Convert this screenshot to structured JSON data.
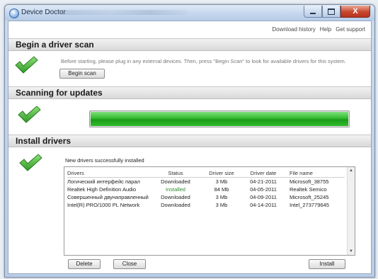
{
  "window": {
    "title": "Device Doctor",
    "controls": {
      "minimize": "minimize",
      "maximize": "maximize",
      "close": "X"
    }
  },
  "top_links": [
    "Download history",
    "Help",
    "Get support"
  ],
  "sections": {
    "scan": {
      "title": "Begin a driver scan",
      "instruction": "Before starting, please plug in any external devices. Then, press \"Begin Scan\" to look for available drivers for this system.",
      "button": "Begin scan"
    },
    "updates": {
      "title": "Scanning for updates",
      "progress": 1.0
    },
    "install": {
      "title": "Install drivers",
      "message": "New drivers successfully installed",
      "columns": [
        "Drivers",
        "Status",
        "Driver size",
        "Driver date",
        "File name"
      ],
      "rows": [
        [
          "Логический интерфейс парал",
          "Downloaded",
          "3 Mb",
          "04-21-2011",
          "Microsoft_38755"
        ],
        [
          "Realtek High Definition Audio",
          "Installed",
          "84 Mb",
          "04-05-2011",
          "Realtek Semico"
        ],
        [
          "Совершенный двунаправленный",
          "Downloaded",
          "3 Mb",
          "04-09-2011",
          "Microsoft_25245"
        ],
        [
          "Intel(R) PRO/1000 PL Network",
          "Downloaded",
          "3 Mb",
          "04-14-2011",
          "Intel_273779645"
        ]
      ],
      "buttons": {
        "delete": "Delete",
        "close": "Close",
        "install": "Install"
      }
    }
  },
  "colors": {
    "installed_status": "#2e8b2e",
    "progress_green": "#2fbc2b",
    "check_green": "#3aa62f"
  },
  "icons": {
    "section_status": "check-icon"
  }
}
